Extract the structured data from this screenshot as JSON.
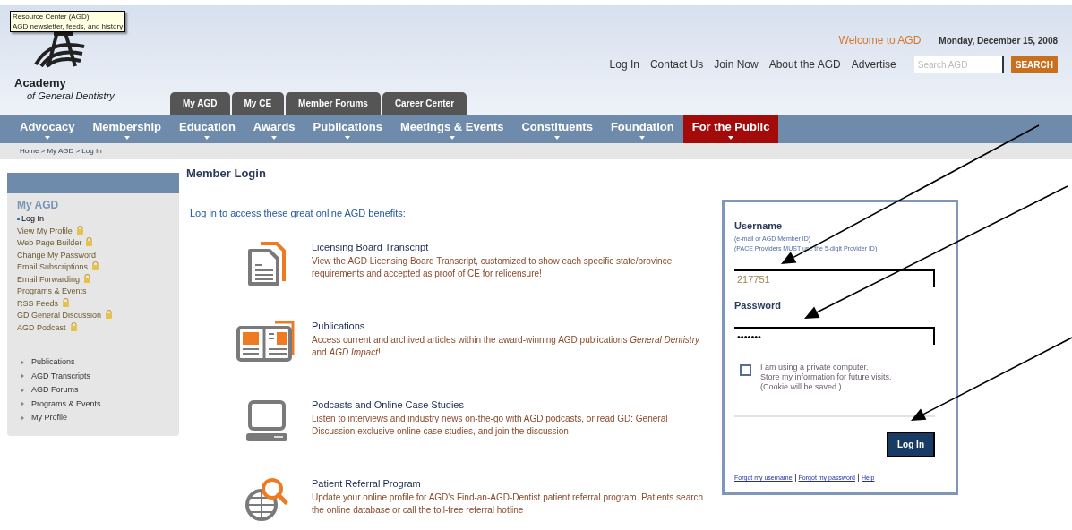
{
  "tooltip": {
    "lines": [
      "Resource Center (AGD)",
      "AGD newsletter, feeds, and history"
    ]
  },
  "logo": {
    "name": "Academy",
    "tagline": "of General Dentistry"
  },
  "header": {
    "welcome": "Welcome to AGD",
    "date": "Monday, December 15, 2008",
    "links": [
      "Log In",
      "Contact Us",
      "Join Now",
      "About the AGD",
      "Advertise"
    ],
    "search": {
      "placeholder": "Search AGD",
      "button": "SEARCH"
    }
  },
  "member_tabs": [
    "My AGD",
    "My CE",
    "Member Forums",
    "Career Center"
  ],
  "nav": [
    {
      "label": "Advocacy",
      "selected": false
    },
    {
      "label": "Membership",
      "selected": false
    },
    {
      "label": "Education",
      "selected": false
    },
    {
      "label": "Awards",
      "selected": false
    },
    {
      "label": "Publications",
      "selected": false
    },
    {
      "label": "Meetings & Events",
      "selected": false
    },
    {
      "label": "Constituents",
      "selected": false
    },
    {
      "label": "Foundation",
      "selected": false
    },
    {
      "label": "For the Public",
      "selected": true
    }
  ],
  "breadcrumb": "Home > My AGD > Log In",
  "sidebar": {
    "title": "My AGD",
    "items": [
      {
        "label": "Log In",
        "selected": true,
        "locked": false
      },
      {
        "label": "View My Profile",
        "selected": false,
        "locked": true
      },
      {
        "label": "Web Page Builder",
        "selected": false,
        "locked": true
      },
      {
        "label": "Change My Password",
        "selected": false,
        "locked": false
      },
      {
        "label": "Email Subscriptions",
        "selected": false,
        "locked": true
      },
      {
        "label": "Email Forwarding",
        "selected": false,
        "locked": true
      },
      {
        "label": "Programs & Events",
        "selected": false,
        "locked": false
      },
      {
        "label": "RSS Feeds",
        "selected": false,
        "locked": true
      },
      {
        "label": "GD General Discussion",
        "selected": false,
        "locked": true
      },
      {
        "label": "AGD Podcast",
        "selected": false,
        "locked": true
      }
    ],
    "sections": [
      "Publications",
      "AGD Transcripts",
      "AGD Forums",
      "Programs & Events",
      "My Profile"
    ]
  },
  "main": {
    "title": "Member Login",
    "intro": "Log in to access these great online AGD benefits:",
    "benefits": [
      {
        "kind": "transcript",
        "title": "Licensing Board Transcript",
        "text": "View the AGD Licensing Board Transcript, customized to show each specific state/province requirements and accepted as proof of CE for relicensure!"
      },
      {
        "kind": "publication",
        "title": "Publications",
        "text": "Access current and archived articles within the award-winning AGD publications *General Dentistry* and *AGD Impact*!"
      },
      {
        "kind": "computer",
        "title": "Podcasts and Online Case Studies",
        "text": "Listen to interviews and industry news on-the-go with AGD podcasts, or read GD: General Discussion exclusive online case studies, and join the discussion"
      },
      {
        "kind": "globe",
        "title": "Patient Referral Program",
        "text": "Update your online profile for AGD's Find-an-AGD-Dentist patient referral program. Patients search the online database or call the toll-free referral hotline"
      }
    ]
  },
  "login": {
    "username_label": "Username",
    "hints": [
      "(e-mail or AGD Member ID)",
      "(PACE Providers MUST use the 5-digit Provider ID)"
    ],
    "username": "217751",
    "password_label": "Password",
    "password": "•••••••",
    "remember": {
      "checked": false,
      "lines": [
        "I am using a private computer.",
        "Store my information for future visits.",
        "(Cookie will be saved.)"
      ]
    },
    "button": "Log In",
    "links": [
      "Forgot my username",
      "Forgot my password",
      "Help"
    ]
  }
}
